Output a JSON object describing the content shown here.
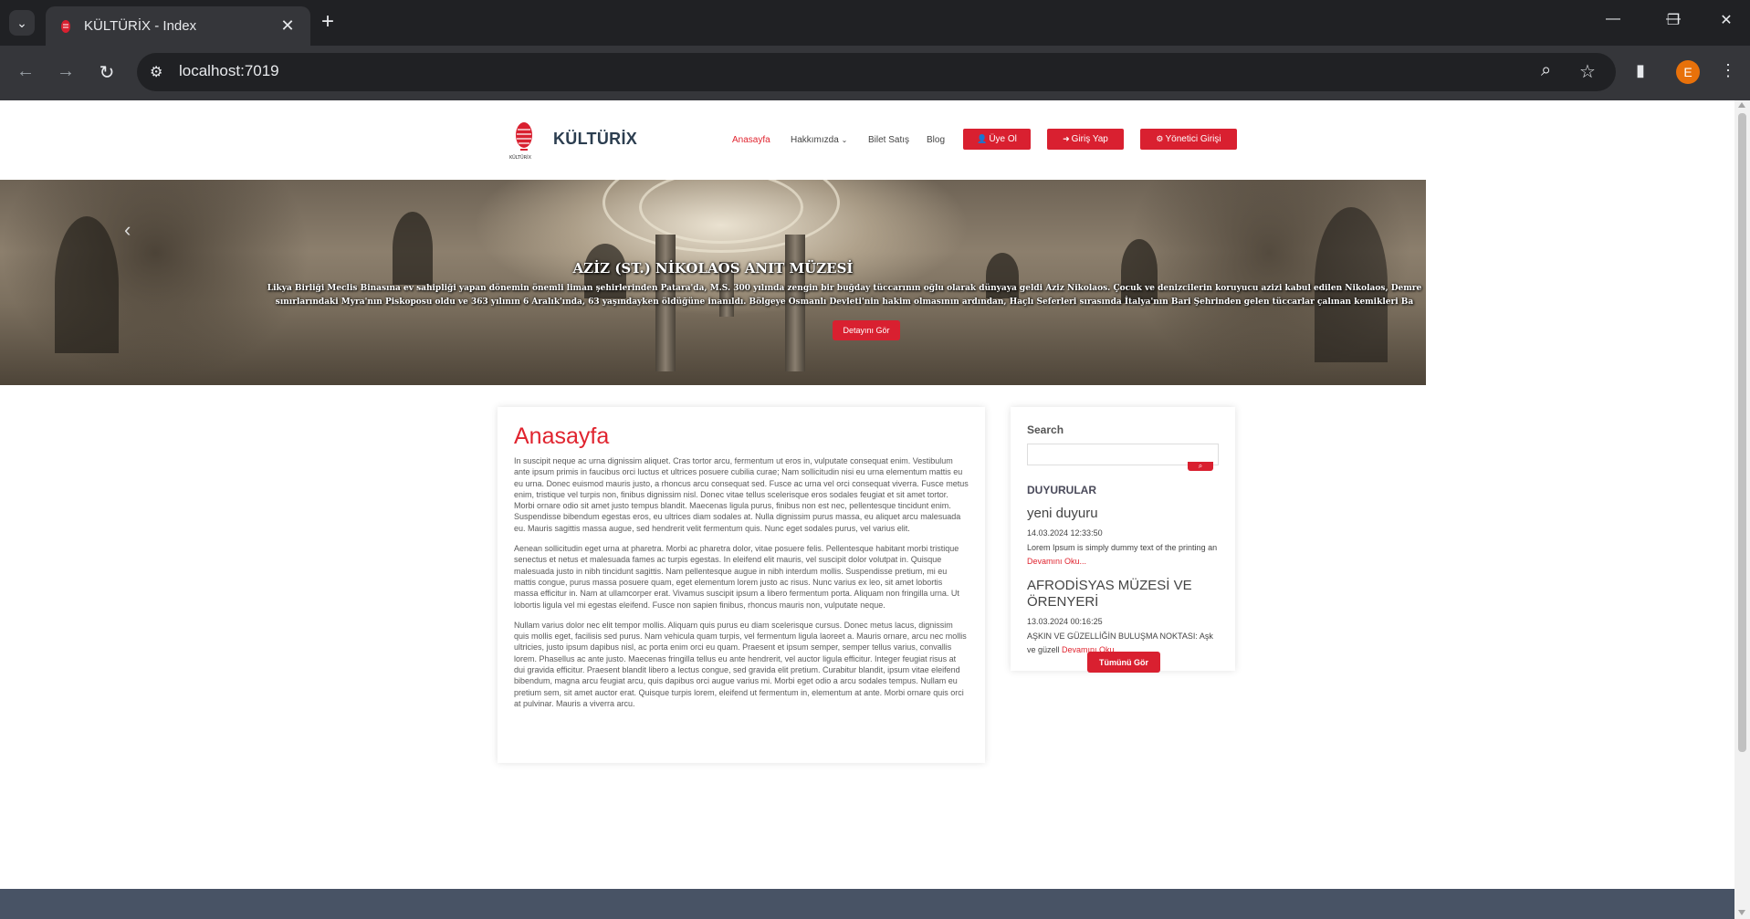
{
  "browser": {
    "tab_title": "KÜLTÜRİX - Index",
    "url": "localhost:7019",
    "profile_initial": "E",
    "accent_profile": "#e8710a"
  },
  "header": {
    "brand": "KÜLTÜRİX",
    "nav": [
      {
        "label": "Anasayfa",
        "active": true
      },
      {
        "label": "Hakkımızda"
      },
      {
        "label": "Bilet Satış"
      },
      {
        "label": "Blog"
      }
    ],
    "buttons": {
      "register": "Üye Ol",
      "login": "Giriş Yap",
      "admin": "Yönetici Girişi"
    }
  },
  "hero": {
    "title": "AZİZ (ST.) NİKOLAOS ANIT MÜZESİ",
    "text": "Likya Birliği Meclis Binasına ev sahipliği yapan dönemin önemli liman şehirlerinden Patara'da, M.S. 300 yılında zengin bir buğday tüccarının oğlu olarak dünyaya geldi Aziz Nikolaos. Çocuk ve denizcilerin koruyucu azizi kabul edilen Nikolaos, Demre sınırlarındaki Myra'nın Piskoposu oldu ve 363 yılının 6 Aralık'ında, 63 yaşındayken öldüğüne inanıldı. Bölgeye Osmanlı Devleti'nin hakim olmasının ardından, Haçlı Seferleri sırasında İtalya'nın Bari Şehrinden gelen tüccarlar çalınan kemikleri Ba",
    "button": "Detayını Gör"
  },
  "main": {
    "title": "Anasayfa",
    "paragraphs": [
      "In suscipit neque ac urna dignissim aliquet. Cras tortor arcu, fermentum ut eros in, vulputate consequat enim. Vestibulum ante ipsum primis in faucibus orci luctus et ultrices posuere cubilia curae; Nam sollicitudin nisi eu urna elementum mattis eu eu urna. Donec euismod mauris justo, a rhoncus arcu consequat sed. Fusce ac urna vel orci consequat viverra. Fusce metus enim, tristique vel turpis non, finibus dignissim nisl. Donec vitae tellus scelerisque eros sodales feugiat et sit amet tortor. Morbi ornare odio sit amet justo tempus blandit. Maecenas ligula purus, finibus non est nec, pellentesque tincidunt enim. Suspendisse bibendum egestas eros, eu ultrices diam sodales at. Nulla dignissim purus massa, eu aliquet arcu malesuada eu. Mauris sagittis massa augue, sed hendrerit velit fermentum quis. Nunc eget sodales purus, vel varius elit.",
      "Aenean sollicitudin eget urna at pharetra. Morbi ac pharetra dolor, vitae posuere felis. Pellentesque habitant morbi tristique senectus et netus et malesuada fames ac turpis egestas. In eleifend elit mauris, vel suscipit dolor volutpat in. Quisque malesuada justo in nibh tincidunt sagittis. Nam pellentesque augue in nibh interdum mollis. Suspendisse pretium, mi eu mattis congue, purus massa posuere quam, eget elementum lorem justo ac risus. Nunc varius ex leo, sit amet lobortis massa efficitur in. Nam at ullamcorper erat. Vivamus suscipit ipsum a libero fermentum porta. Aliquam non fringilla urna. Ut lobortis ligula vel mi egestas eleifend. Fusce non sapien finibus, rhoncus mauris non, vulputate neque.",
      "Nullam varius dolor nec elit tempor mollis. Aliquam quis purus eu diam scelerisque cursus. Donec metus lacus, dignissim quis mollis eget, facilisis sed purus. Nam vehicula quam turpis, vel fermentum ligula laoreet a. Mauris ornare, arcu nec mollis ultricies, justo ipsum dapibus nisl, ac porta enim orci eu quam. Praesent et ipsum semper, semper tellus varius, convallis lorem. Phasellus ac ante justo. Maecenas fringilla tellus eu ante hendrerit, vel auctor ligula efficitur. Integer feugiat risus at dui gravida efficitur. Praesent blandit libero a lectus congue, sed gravida elit pretium. Curabitur blandit, ipsum vitae eleifend bibendum, magna arcu feugiat arcu, quis dapibus orci augue varius mi. Morbi eget odio a arcu sodales tempus. Nullam eu pretium sem, sit amet auctor erat. Quisque turpis lorem, eleifend ut fermentum in, elementum at ante. Morbi ornare quis orci at pulvinar. Mauris a viverra arcu."
    ]
  },
  "sidebar": {
    "search_label": "Search",
    "search_value": "",
    "announcements_heading": "DUYURULAR",
    "announcements": [
      {
        "title": "yeni duyuru",
        "date": "14.03.2024 12:33:50",
        "excerpt": "Lorem Ipsum is simply dummy text of the printing an",
        "more": "Devamını Oku..."
      },
      {
        "title": "AFRODİSYAS MÜZESİ VE ÖRENYERİ",
        "date": "13.03.2024 00:16:25",
        "excerpt": "AŞKIN VE GÜZELLİĞİN BULUŞMA NOKTASI: Aşk ve güzell",
        "more": "Devamını Oku..."
      }
    ],
    "all_button": "Tümünü Gör"
  },
  "colors": {
    "accent_red": "#d92030",
    "title_red": "#e0242f",
    "footer": "#485365"
  }
}
